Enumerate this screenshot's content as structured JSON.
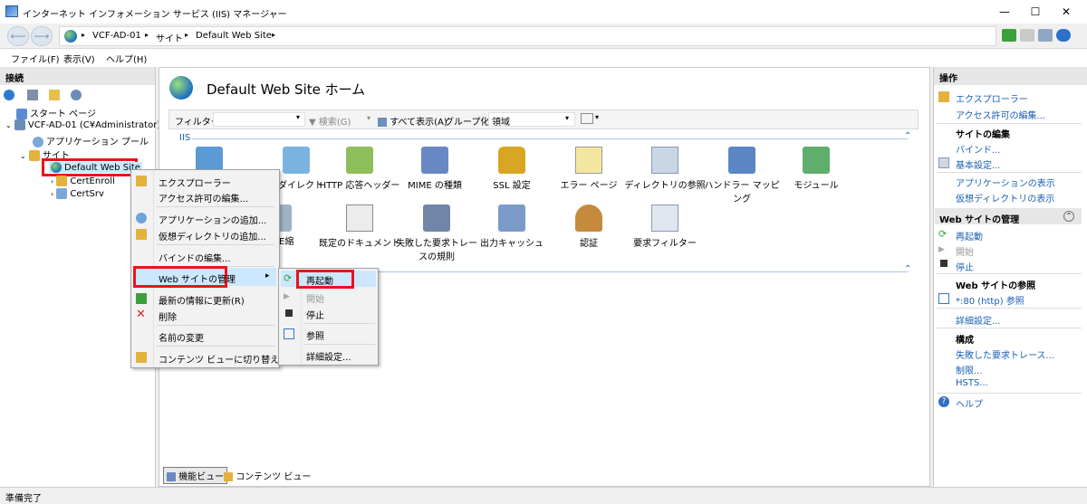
{
  "window": {
    "title": "インターネット インフォメーション サービス (IIS) マネージャー",
    "minimize": "—",
    "maximize": "☐",
    "close": "✕"
  },
  "address": {
    "crumbs": [
      "VCF-AD-01",
      "サイト",
      "Default Web Site"
    ],
    "arrow": "▸"
  },
  "menubar": [
    "ファイル(F)",
    "表示(V)",
    "ヘルプ(H)"
  ],
  "left_panel": {
    "header": "接続",
    "tree": [
      {
        "label": "スタート ページ"
      },
      {
        "label": "VCF-AD-01 (C¥Administrator)"
      },
      {
        "label": "アプリケーション プール"
      },
      {
        "label": "サイト"
      },
      {
        "label": "Default Web Site"
      },
      {
        "label": "CertEnroll"
      },
      {
        "label": "CertSrv"
      }
    ]
  },
  "center": {
    "title": "Default Web Site ホーム",
    "filter_label": "フィルター:",
    "search_label": "検索(G)",
    "show_all_label": "すべて表示(A)",
    "group_label": "グループ化:",
    "group_value": "領域",
    "section_iis": "IIS",
    "features_row1": [
      "リダイレクト",
      "HTTP 応答ヘッダー",
      "MIME の種類",
      "SSL 設定",
      "エラー ページ",
      "ディレクトリの参照",
      "ハンドラー マッピング",
      "モジュール"
    ],
    "features_row2_partial": "E縮",
    "features_row2": [
      "既定のドキュメント",
      "失敗した要求トレースの規則",
      "出力キャッシュ",
      "認証",
      "要求フィルター"
    ],
    "feature_view_tab": "機能ビュー",
    "content_view_tab": "コンテンツ ビュー"
  },
  "context_menu": {
    "items": [
      "エクスプローラー",
      "アクセス許可の編集...",
      "アプリケーションの追加...",
      "仮想ディレクトリの追加...",
      "バインドの編集...",
      "Web サイトの管理",
      "最新の情報に更新(R)",
      "削除",
      "名前の変更",
      "コンテンツ ビューに切り替え"
    ],
    "submenu_arrow": "▸"
  },
  "submenu": {
    "items": [
      "再起動",
      "開始",
      "停止",
      "参照",
      "詳細設定..."
    ]
  },
  "right_panel": {
    "header": "操作",
    "explore": "エクスプローラー",
    "edit_perm": "アクセス許可の編集...",
    "edit_site_head": "サイトの編集",
    "bindings": "バインド...",
    "basic_settings": "基本設定...",
    "view_apps": "アプリケーションの表示",
    "view_vdirs": "仮想ディレクトリの表示",
    "manage_head": "Web サイトの管理",
    "restart": "再起動",
    "start": "開始",
    "stop": "停止",
    "browse_head": "Web サイトの参照",
    "browse_80": "*:80 (http) 参照",
    "advanced": "詳細設定...",
    "config_head": "構成",
    "failed_trace": "失敗した要求トレース...",
    "limits": "制限...",
    "hsts": "HSTS...",
    "help": "ヘルプ"
  },
  "status": {
    "text": "準備完了"
  },
  "colors": {
    "link": "#1a5fb4",
    "highlight_red": "#e8141a",
    "selection": "#cce8ff"
  }
}
